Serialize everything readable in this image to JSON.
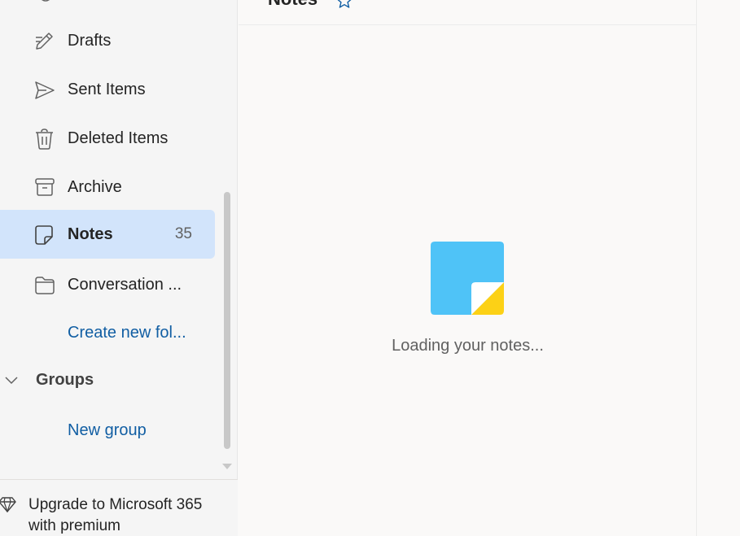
{
  "sidebar": {
    "folders": [
      {
        "label": "Drafts",
        "icon": "pencil-icon",
        "count": ""
      },
      {
        "label": "Sent Items",
        "icon": "send-icon",
        "count": ""
      },
      {
        "label": "Deleted Items",
        "icon": "trash-icon",
        "count": ""
      },
      {
        "label": "Archive",
        "icon": "archive-icon",
        "count": ""
      },
      {
        "label": "Notes",
        "icon": "note-icon",
        "count": "35",
        "selected": true
      },
      {
        "label": "Conversation ...",
        "icon": "folder-icon",
        "count": ""
      }
    ],
    "create_folder_label": "Create new fol...",
    "groups_label": "Groups",
    "new_group_label": "New group",
    "upgrade_text": "Upgrade to Microsoft 365 with premium"
  },
  "main": {
    "title": "Notes",
    "loading_text": "Loading your notes..."
  },
  "colors": {
    "selected_bg": "#d2e4fb",
    "link": "#115ea3",
    "note_blue": "#4fc3f7",
    "note_yellow": "#fcd116"
  }
}
